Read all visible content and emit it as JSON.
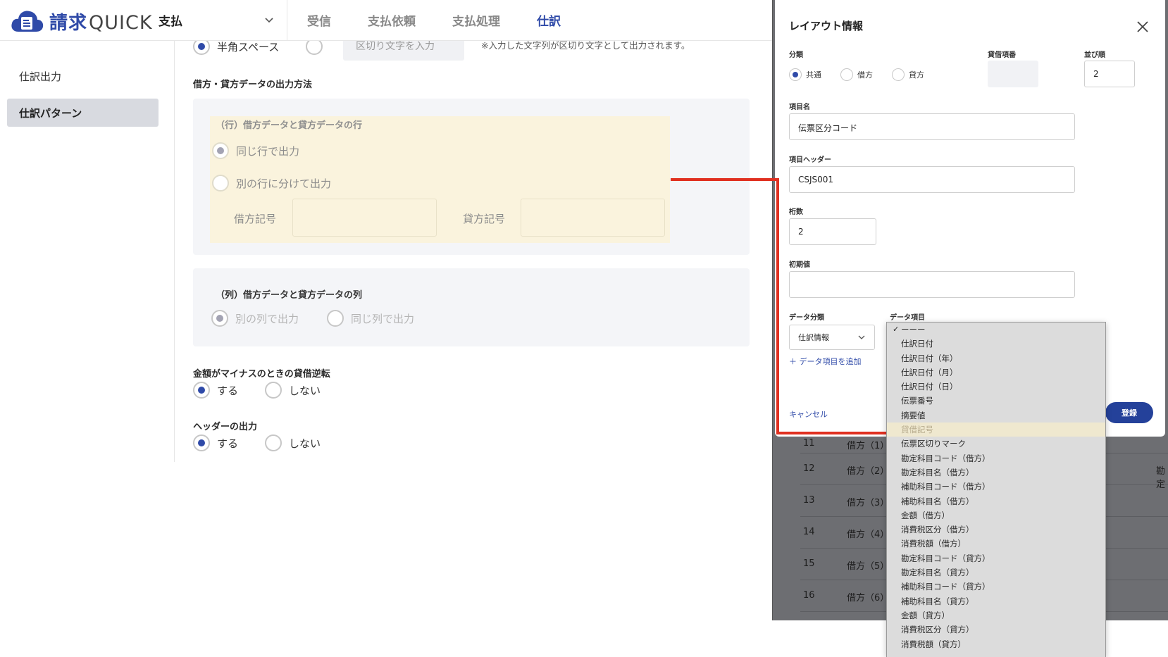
{
  "header": {
    "logo_jp": "請求",
    "logo_en": "QUICK",
    "module": "支払",
    "tabs": [
      {
        "label": "受信"
      },
      {
        "label": "支払依頼"
      },
      {
        "label": "支払処理"
      },
      {
        "label": "仕訳"
      }
    ],
    "active_tab": "仕訳"
  },
  "sidebar": {
    "items": [
      {
        "label": "仕訳出力"
      },
      {
        "label": "仕訳パターン"
      }
    ],
    "active": "仕訳パターン"
  },
  "main": {
    "top_row": {
      "option1": "半角スペース",
      "input_placeholder": "区切り文字を入力",
      "note": "※入力した文字列が区切り文字として出力されます。"
    },
    "output_method_title": "借方・貸方データの出力方法",
    "row_box": {
      "title": "（行）借方データと貸方データの行",
      "option_same": "同じ行で出力",
      "option_split": "別の行に分けて出力",
      "debit_symbol_label": "借方記号",
      "credit_symbol_label": "貸方記号"
    },
    "col_box": {
      "title": "（列）借方データと貸方データの列",
      "option_other": "別の列で出力",
      "option_same": "同じ列で出力"
    },
    "negative_title": "金額がマイナスのときの貸借逆転",
    "negative_yes": "する",
    "negative_no": "しない",
    "header_output_title": "ヘッダーの出力",
    "header_yes": "する",
    "header_no": "しない"
  },
  "modal": {
    "title": "レイアウト情報",
    "category_label": "分類",
    "category_options": [
      "共通",
      "借方",
      "貸方"
    ],
    "category_selected": "共通",
    "dc_item_label": "貸借項番",
    "order_label": "並び順",
    "order_value": "2",
    "item_name_label": "項目名",
    "item_name_value": "伝票区分コード",
    "item_header_label": "項目ヘッダー",
    "item_header_value": "CSJS001",
    "digits_label": "桁数",
    "digits_value": "2",
    "initial_label": "初期値",
    "initial_value": "",
    "data_category_label": "データ分類",
    "data_category_value": "仕訳情報",
    "data_item_label": "データ項目",
    "add_data_item": "＋ データ項目を追加",
    "cancel": "キャンセル",
    "register": "登録"
  },
  "dropdown": {
    "selected": "ーーー",
    "items": [
      "ーーー",
      "仕訳日付",
      "仕訳日付（年）",
      "仕訳日付（月）",
      "仕訳日付（日）",
      "伝票番号",
      "摘要値",
      "貸借記号",
      "伝票区切りマーク",
      "勘定科目コード（借方）",
      "勘定科目名（借方）",
      "補助科目コード（借方）",
      "補助科目名（借方）",
      "金額（借方）",
      "消費税区分（借方）",
      "消費税額（借方）",
      "勘定科目コード（貸方）",
      "勘定科目名（貸方）",
      "補助科目コード（貸方）",
      "補助科目名（貸方）",
      "金額（貸方）",
      "消費税区分（貸方）",
      "消費税額（貸方）"
    ],
    "highlighted": "貸借記号"
  },
  "background_table": {
    "rows": [
      {
        "no": "11",
        "label": "借方（1）"
      },
      {
        "no": "12",
        "label": "借方（2）",
        "extra": "勘定"
      },
      {
        "no": "13",
        "label": "借方（3）"
      },
      {
        "no": "14",
        "label": "借方（4）"
      },
      {
        "no": "15",
        "label": "借方（5）"
      },
      {
        "no": "16",
        "label": "借方（6）"
      }
    ]
  },
  "colors": {
    "brand": "#2f4aa8",
    "accent_red": "#e03020",
    "highlight_yellow": "#faf3dd"
  }
}
